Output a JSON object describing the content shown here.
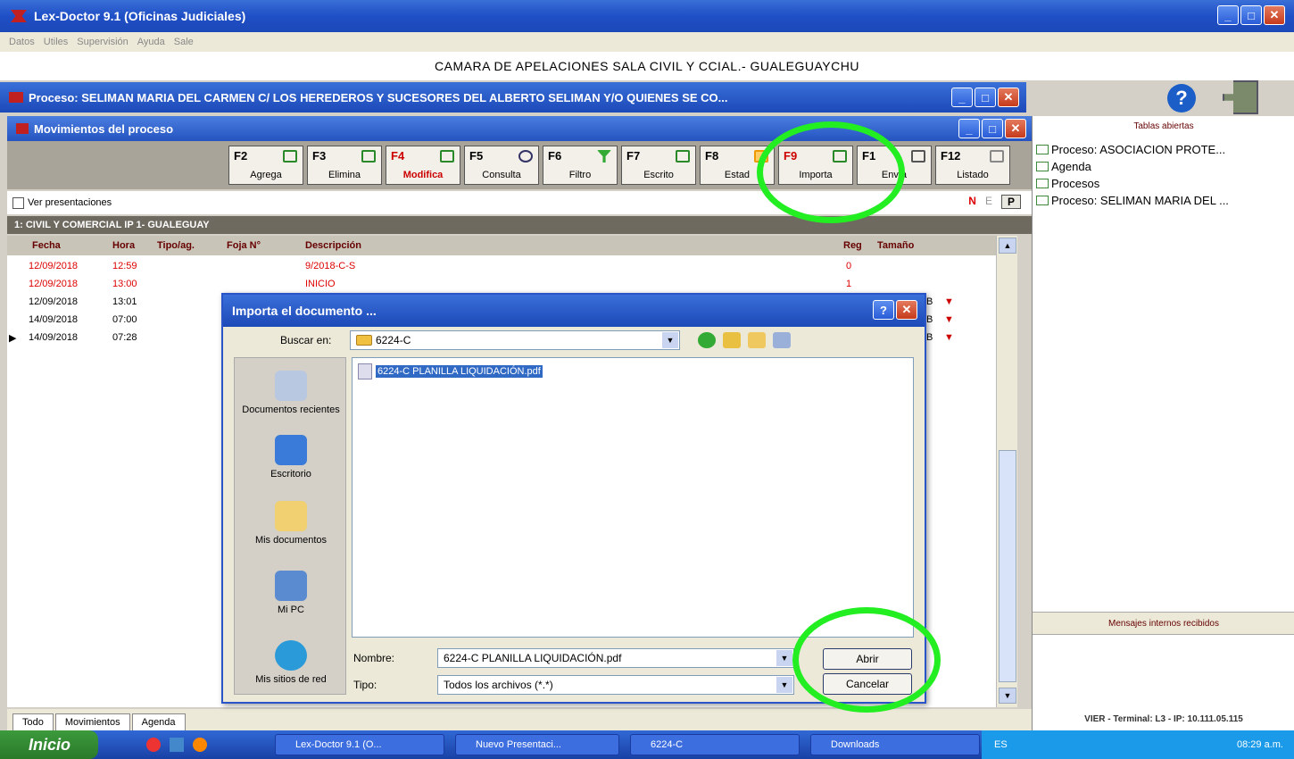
{
  "app": {
    "title": "Lex-Doctor 9.1 (Oficinas Judiciales)",
    "menu": [
      "Datos",
      "Utiles",
      "Supervisión",
      "Ayuda",
      "Sale"
    ],
    "caption": "CAMARA DE APELACIONES SALA CIVIL Y CCIAL.- GUALEGUAYCHU"
  },
  "process_window": {
    "title": "Proceso: SELIMAN MARIA DEL CARMEN C/ LOS HEREDEROS Y SUCESORES DEL ALBERTO SELIMAN Y/O QUIENES SE CO..."
  },
  "movements_window": {
    "title": "Movimientos del proceso"
  },
  "toolbar": [
    {
      "key": "F2",
      "label": "Agrega"
    },
    {
      "key": "F3",
      "label": "Elimina"
    },
    {
      "key": "F4",
      "label": "Modifica"
    },
    {
      "key": "F5",
      "label": "Consulta"
    },
    {
      "key": "F6",
      "label": "Filtro"
    },
    {
      "key": "F7",
      "label": "Escrito"
    },
    {
      "key": "F8",
      "label": "Estad"
    },
    {
      "key": "F9",
      "label": "Importa"
    },
    {
      "key": "F1",
      "label": "Envía"
    },
    {
      "key": "F12",
      "label": "Listado"
    }
  ],
  "view": {
    "ver_presentaciones": "Ver presentaciones",
    "n": "N",
    "e": "E",
    "p": "P"
  },
  "group": "1: CIVIL Y COMERCIAL IP 1- GUALEGUAY",
  "grid": {
    "headers": {
      "fecha": "Fecha",
      "hora": "Hora",
      "tipo": "Tipo/ag.",
      "foja": "Foja N°",
      "descripcion": "Descripción",
      "reg": "Reg",
      "tamano": "Tamaño"
    },
    "rows": [
      {
        "marker": "",
        "fecha": "12/09/2018",
        "hora": "12:59",
        "desc": "9/2018-C-S",
        "reg": "0",
        "size": ""
      },
      {
        "marker": "",
        "fecha": "12/09/2018",
        "hora": "13:00",
        "desc": "INICIO",
        "reg": "1",
        "size": ""
      },
      {
        "marker": "",
        "fecha": "12/09/2018",
        "hora": "13:01",
        "desc": "",
        "reg": "",
        "size": "B"
      },
      {
        "marker": "",
        "fecha": "14/09/2018",
        "hora": "07:00",
        "desc": "",
        "reg": "",
        "size": "B"
      },
      {
        "marker": "▶",
        "fecha": "14/09/2018",
        "hora": "07:28",
        "desc": "",
        "reg": "",
        "size": "B"
      }
    ]
  },
  "bottom_tabs": [
    "Todo",
    "Movimientos",
    "Agenda"
  ],
  "right_panel": {
    "header": "Tablas abiertas",
    "items": [
      "Proceso: ASOCIACION PROTE...",
      "Agenda",
      "Procesos",
      "Proceso: SELIMAN MARIA DEL ..."
    ],
    "messages": "Mensajes internos recibidos",
    "status": "VIER - Terminal: L3 - IP: 10.111.05.115"
  },
  "dialog": {
    "title": "Importa el documento ...",
    "look_in_label": "Buscar en:",
    "look_in_value": "6224-C",
    "places": [
      "Documentos recientes",
      "Escritorio",
      "Mis documentos",
      "Mi PC",
      "Mis sitios de red"
    ],
    "files": [
      "6224-C PLANILLA LIQUIDACIÓN.pdf"
    ],
    "name_label": "Nombre:",
    "name_value": "6224-C PLANILLA LIQUIDACIÓN.pdf",
    "type_label": "Tipo:",
    "type_value": "Todos los archivos (*.*)",
    "open": "Abrir",
    "cancel": "Cancelar"
  },
  "taskbar": {
    "start": "Inicio",
    "tasks": [
      "Lex-Doctor 9.1 (O...",
      "Nuevo Presentaci...",
      "6224-C",
      "Downloads"
    ],
    "lang": "ES",
    "time": "08:29 a.m."
  }
}
